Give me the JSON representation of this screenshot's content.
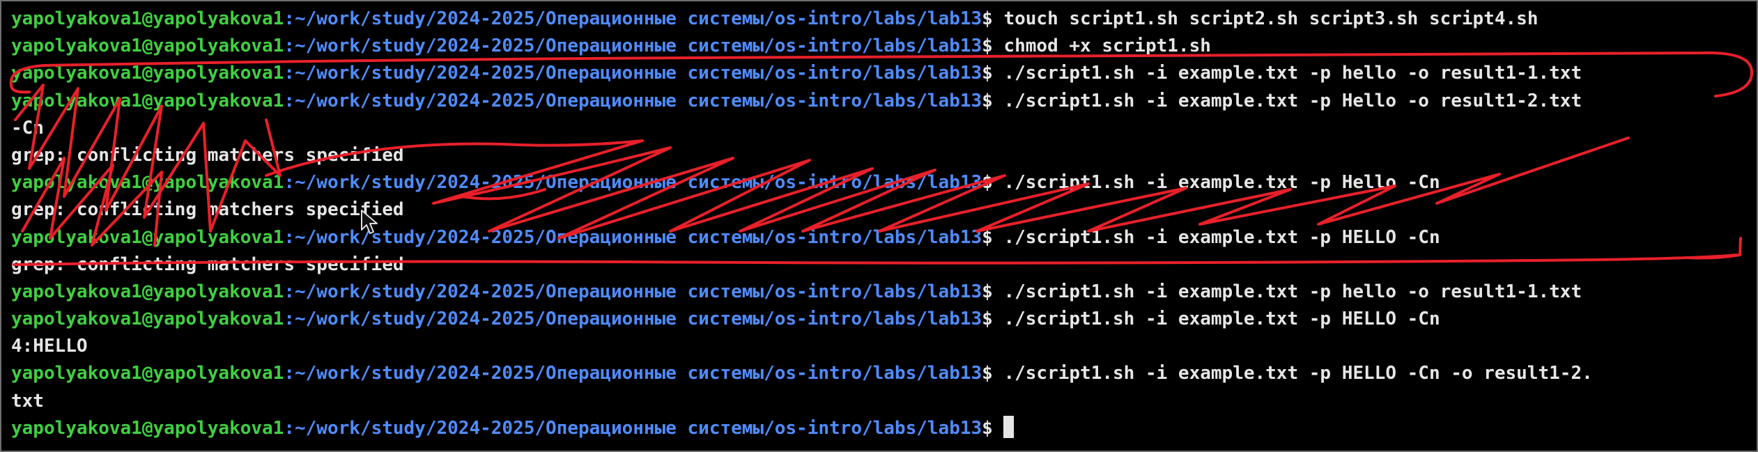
{
  "terminal": {
    "colors": {
      "background": "#000000",
      "user_host": "#3fd13f",
      "path": "#4f8cff",
      "text": "#e6e6e6",
      "annotation": "#e8202a"
    },
    "prompt_user": "yapolyakova1@yapolyakova1",
    "prompt_path": ":~/work/study/2024-2025/Операционные системы/os-intro/labs/lab13",
    "prompt_symbol": "$ ",
    "lines": [
      {
        "type": "cmd",
        "text": "touch script1.sh script2.sh script3.sh script4.sh"
      },
      {
        "type": "cmd",
        "text": "chmod +x script1.sh"
      },
      {
        "type": "cmd",
        "text": "./script1.sh -i example.txt -p hello -o result1-1.txt"
      },
      {
        "type": "cmd",
        "text": "./script1.sh -i example.txt -p Hello -o result1-2.txt"
      },
      {
        "type": "out",
        "text": "-Cn"
      },
      {
        "type": "out",
        "text": "grep: conflicting matchers specified"
      },
      {
        "type": "cmd",
        "text": "./script1.sh -i example.txt -p Hello -Cn"
      },
      {
        "type": "out",
        "text": "grep: conflicting matchers specified"
      },
      {
        "type": "cmd",
        "text": "./script1.sh -i example.txt -p HELLO -Cn"
      },
      {
        "type": "out",
        "text": "grep: conflicting matchers specified"
      },
      {
        "type": "cmd",
        "text": "./script1.sh -i example.txt -p hello -o result1-1.txt"
      },
      {
        "type": "cmd",
        "text": "./script1.sh -i example.txt -p HELLO -Cn"
      },
      {
        "type": "out",
        "text": "4:HELLO"
      },
      {
        "type": "cmd",
        "text": "./script1.sh -i example.txt -p HELLO -Cn -o result1-2."
      },
      {
        "type": "out",
        "text": "txt"
      },
      {
        "type": "cmd",
        "text": "",
        "cursor": true
      }
    ]
  }
}
